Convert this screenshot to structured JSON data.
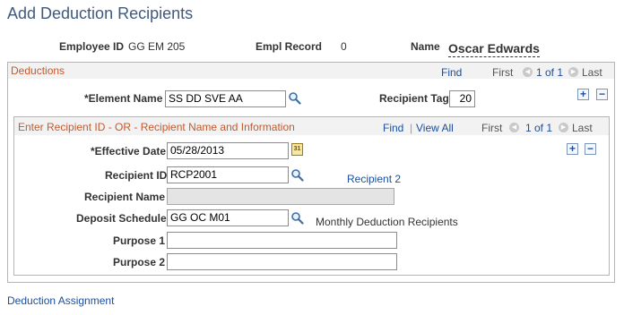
{
  "page": {
    "title": "Add Deduction Recipients"
  },
  "header": {
    "employee_id_label": "Employee ID",
    "employee_id_value": "GG EM 205",
    "empl_record_label": "Empl Record",
    "empl_record_value": "0",
    "name_label": "Name",
    "name_value": "Oscar Edwards"
  },
  "deductions": {
    "title": "Deductions",
    "find": "Find",
    "first": "First",
    "position": "1 of 1",
    "last": "Last",
    "element_name_label": "*Element Name",
    "element_name_value": "SS DD SVE AA",
    "recipient_tag_label": "Recipient Tag",
    "recipient_tag_value": "20",
    "add_label": "+",
    "delete_label": "−"
  },
  "recipient": {
    "title": "Enter Recipient ID - OR - Recipient Name and Information",
    "find": "Find",
    "separator": "|",
    "view_all": "View All",
    "first": "First",
    "position": "1 of 1",
    "last": "Last",
    "add_label": "+",
    "delete_label": "−",
    "effective_date_label": "*Effective Date",
    "effective_date_value": "05/28/2013",
    "recipient_id_label": "Recipient ID",
    "recipient_id_value": "RCP2001",
    "recipient_id_link": "Recipient 2",
    "recipient_name_label": "Recipient Name",
    "recipient_name_value": "",
    "deposit_schedule_label": "Deposit Schedule",
    "deposit_schedule_value": "GG OC M01",
    "deposit_schedule_desc": "Monthly Deduction Recipients",
    "purpose1_label": "Purpose 1",
    "purpose1_value": "",
    "purpose2_label": "Purpose 2",
    "purpose2_value": ""
  },
  "footer": {
    "link": "Deduction Assignment"
  },
  "icons": {
    "lookup": "magnifier-icon",
    "calendar": "calendar-icon",
    "nav_prev": "previous-arrow-icon",
    "nav_next": "next-arrow-icon"
  }
}
